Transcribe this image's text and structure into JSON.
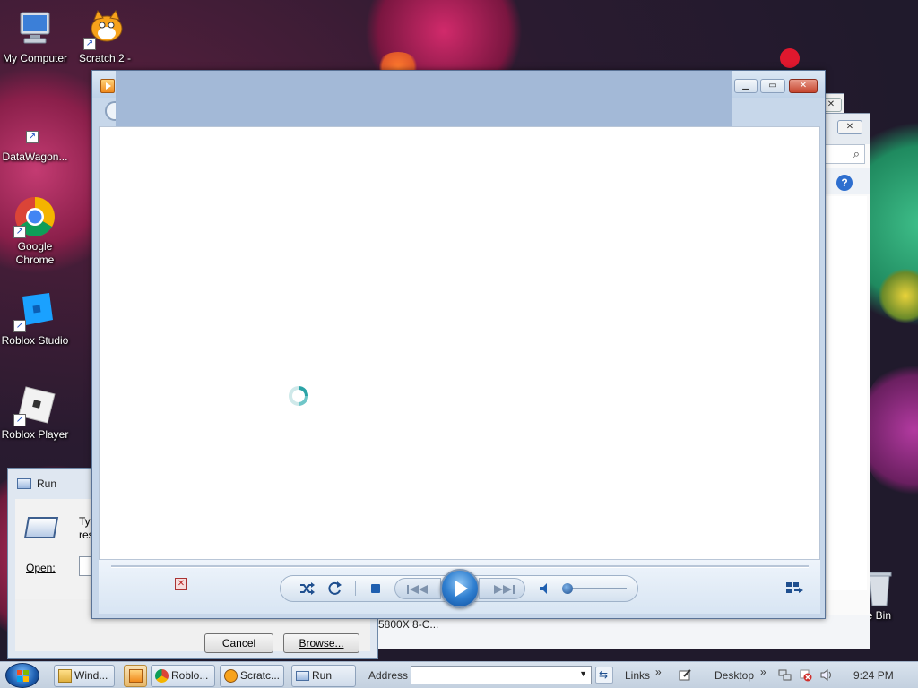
{
  "desktop": {
    "icons": [
      {
        "label": "My Computer",
        "icon": "computer-icon"
      },
      {
        "label": "Scratch 2 -",
        "icon": "scratch-cat-icon"
      },
      {
        "label": "DataWagon...",
        "icon": "datawagon-icon"
      },
      {
        "label": "Google Chrome",
        "icon": "chrome-icon"
      },
      {
        "label": "Roblox Studio",
        "icon": "roblox-studio-icon"
      },
      {
        "label": "Roblox Player",
        "icon": "roblox-player-icon"
      },
      {
        "label": "cle Bin",
        "icon": "recycle-bin-icon"
      }
    ],
    "partial_text": "5800X 8-C..."
  },
  "run_dialog": {
    "title": "Run",
    "description_line1": "Type",
    "description_line2": "reso",
    "open_label": "Open:",
    "open_value": "",
    "cancel_label": "Cancel",
    "browse_label": "Browse..."
  },
  "media_player": {
    "state": "loading",
    "controls": {
      "shuffle": "shuffle-icon",
      "repeat": "repeat-icon",
      "stop": "stop-icon",
      "previous": "previous-icon",
      "play": "play-icon",
      "next": "next-icon",
      "mute": "volume-icon",
      "volume_level": 0.0,
      "switch_view": "switch-to-now-playing-icon"
    }
  },
  "taskbar": {
    "start": "windows-start-orb",
    "buttons": [
      {
        "label": "Wind...",
        "icon": "explorer-icon"
      },
      {
        "label": "",
        "icon": "media-player-icon"
      },
      {
        "label": "Roblo...",
        "icon": "chrome-icon"
      },
      {
        "label": "Scratc...",
        "icon": "scratch-cat-icon"
      },
      {
        "label": "Run",
        "icon": "run-icon"
      }
    ],
    "address_label": "Address",
    "address_value": "",
    "links_label": "Links",
    "desktop_label": "Desktop",
    "clock": "9:24 PM"
  },
  "colors": {
    "accent": "#3a7bd5",
    "wmp_frame": "#c7d7ea",
    "taskbar": "#d1dcea",
    "close_red": "#c6462f"
  }
}
